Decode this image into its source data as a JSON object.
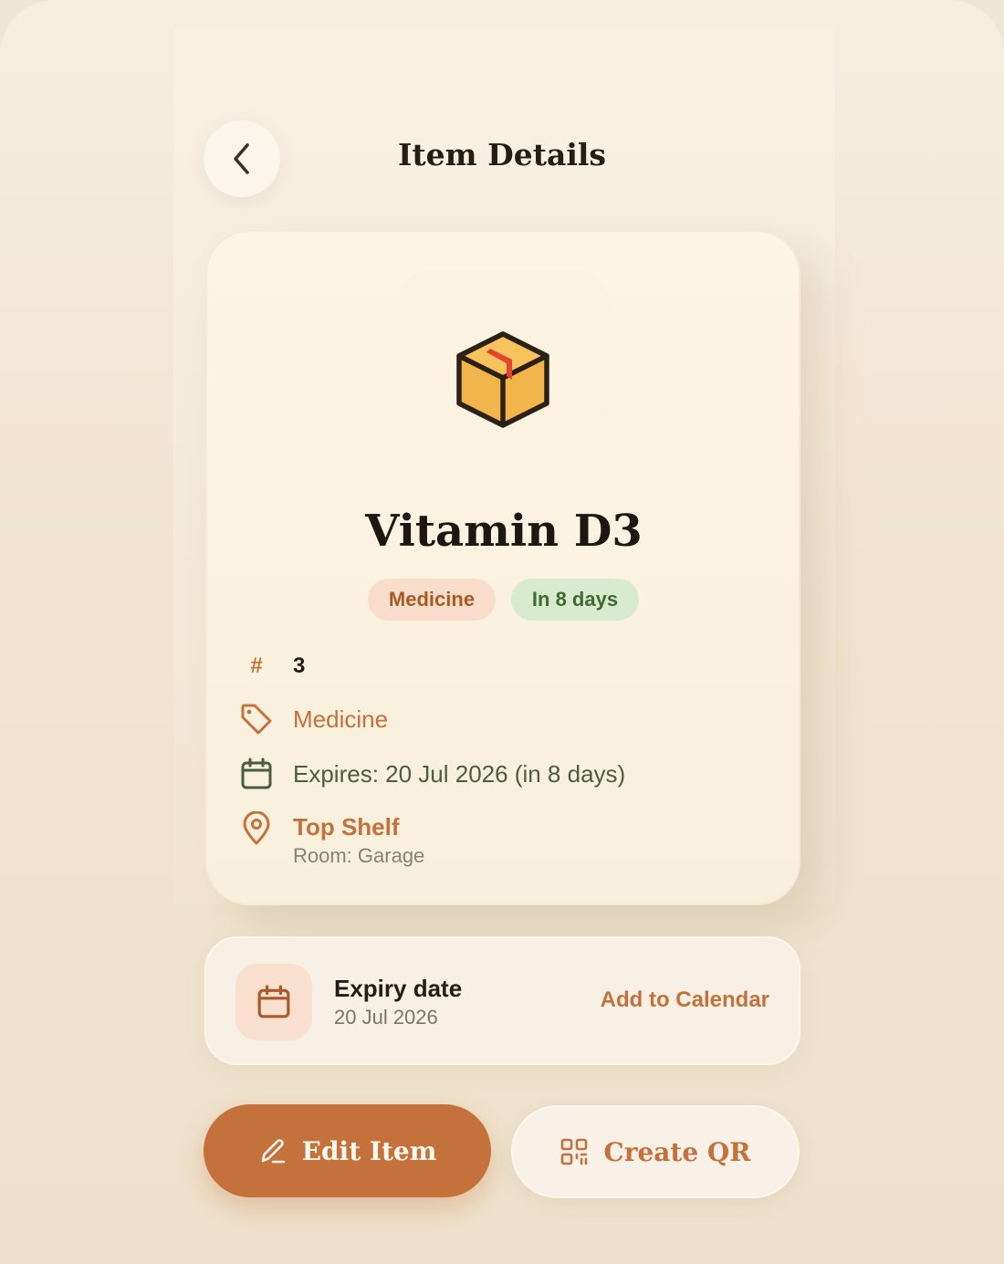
{
  "header": {
    "title": "Item Details",
    "back_icon": "chevron-left-icon"
  },
  "item": {
    "icon": "package-box-icon",
    "name": "Vitamin D3",
    "category_chip": "Medicine",
    "status_chip": "In 8 days",
    "quantity_symbol": "#",
    "quantity": "3",
    "category": "Medicine",
    "expires_text": "Expires: 20 Jul 2026 (in 8 days)",
    "location": "Top Shelf",
    "room": "Room: Garage"
  },
  "expiry_card": {
    "label": "Expiry date",
    "date": "20 Jul 2026",
    "action": "Add to Calendar"
  },
  "actions": {
    "edit_label": "Edit Item",
    "qr_label": "Create QR"
  },
  "colors": {
    "accent": "#c4713b",
    "background": "#f0e6d6",
    "card": "#fdf4e1",
    "status_green_bg": "#d8eccd",
    "status_green_text": "#3e6a33",
    "category_bg": "#f9ddcb"
  }
}
